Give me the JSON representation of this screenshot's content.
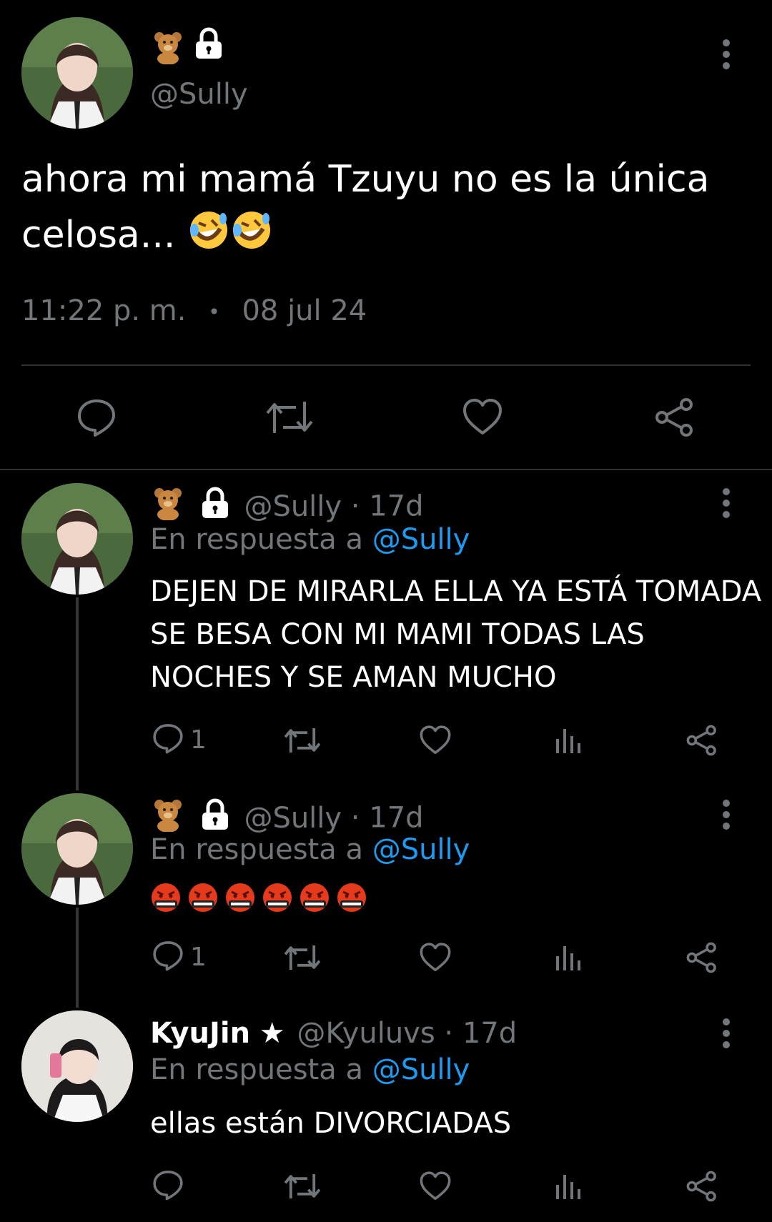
{
  "colors": {
    "background": "#000000",
    "text": "#e7e9ea",
    "muted": "#71767b",
    "link": "#1d9bf0",
    "divider": "#2f3336"
  },
  "main_tweet": {
    "display_icons": [
      "teddy-bear-emoji",
      "lock-icon"
    ],
    "handle": "@Sully",
    "text_line1": "ahora mi mamá Tzuyu no es la única",
    "text_line2": "celosa... ",
    "emoji": [
      "rolling-on-floor-laughing",
      "rolling-on-floor-laughing"
    ],
    "time": "11:22 p. m.",
    "separator": "•",
    "date": "08 jul 24",
    "actions": [
      "reply-icon",
      "retweet-icon",
      "like-icon",
      "share-icon"
    ]
  },
  "replies": [
    {
      "display_icons": [
        "teddy-bear-emoji",
        "lock-icon"
      ],
      "handle": "@Sully",
      "age": "· 17d",
      "reply_prefix": "En respuesta a ",
      "reply_to": "@Sully",
      "text_lines": [
        "DEJEN DE MIRARLA ELLA YA ESTÁ TOMADA",
        "SE BESA CON MI MAMI TODAS LAS",
        "NOCHES Y SE AMAN MUCHO"
      ],
      "reply_count": "1"
    },
    {
      "display_icons": [
        "teddy-bear-emoji",
        "lock-icon"
      ],
      "handle": "@Sully",
      "age": "· 17d",
      "reply_prefix": "En respuesta a ",
      "reply_to": "@Sully",
      "emoji": [
        "face-with-symbols-on-mouth",
        "face-with-symbols-on-mouth",
        "face-with-symbols-on-mouth",
        "face-with-symbols-on-mouth",
        "face-with-symbols-on-mouth",
        "face-with-symbols-on-mouth"
      ],
      "reply_count": "1"
    },
    {
      "name": "KyuJin",
      "star": "★",
      "handle": "@Kyuluvs",
      "age": "· 17d",
      "reply_prefix": "En respuesta a ",
      "reply_to": "@Sully",
      "text": "ellas están DIVORCIADAS",
      "reply_count": ""
    }
  ]
}
